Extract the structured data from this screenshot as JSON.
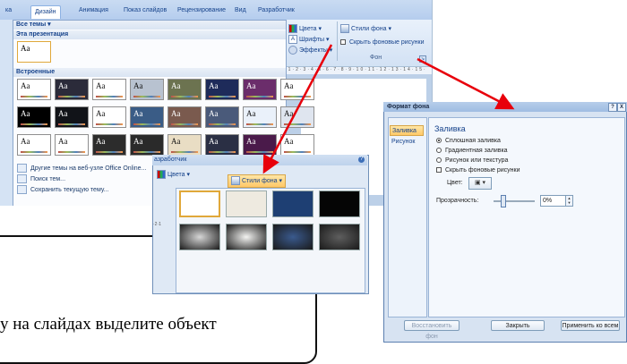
{
  "ribbon": {
    "tabs": [
      "ка",
      "Дизайн",
      "Анимация",
      "Показ слайдов",
      "Рецензирование",
      "Вид",
      "Разработчик"
    ],
    "active_tab_index": 1,
    "colors_label": "Цвета",
    "fonts_label": "Шрифты",
    "effects_label": "Эффекты",
    "bg_styles_label": "Стили фона",
    "hide_bg_graphics_label": "Скрыть фоновые рисунки",
    "group_label": "Фон",
    "ruler_text": "·1·2·3·4·5·6·7·8·9·10·11·12·13·14·15·"
  },
  "gallery": {
    "all_themes": "Все темы",
    "this_presentation": "Эта презентация",
    "builtin": "Встроенные",
    "thumb_text": "Aa",
    "menu": [
      {
        "label": "Другие темы на веб-узле Office Online...",
        "icon": "globe-icon"
      },
      {
        "label": "Поиск тем...",
        "icon": "folder-icon"
      },
      {
        "label": "Сохранить текущую тему...",
        "icon": "save-icon"
      }
    ]
  },
  "theme_colors": [
    [
      "#ffffff",
      "#2b2b3a",
      "#ffffff",
      "#b8c2d0",
      "#6c7350",
      "#1e2b5a",
      "#6b2d6b",
      "#ffffff"
    ],
    [
      "#000000",
      "#111318",
      "#ffffff",
      "#3a5c86",
      "#7a5a4e",
      "#4a5a7a",
      "#eaf1fa",
      "#dfe5ef"
    ],
    [
      "#ffffff",
      "#ffffff",
      "#2c2c2c",
      "#2a2a2a",
      "#e9ddc4",
      "#2a2f44",
      "#4a1a4a",
      "#ffffff"
    ]
  ],
  "popup": {
    "title": "азработчик",
    "colors_label": "Цвета",
    "bg_styles_label": "Стили фона",
    "scale_text": "·2·1",
    "swatches": [
      "#ffffff",
      "#eeeae0",
      "#1e3f73",
      "#050505",
      "#d6d6d6",
      "#f4f4f2",
      "#3a5a8e",
      "#5e5e5e"
    ]
  },
  "slide": {
    "text": "у на слайдах выделите объект"
  },
  "dialog": {
    "title": "Формат фона",
    "help": "?",
    "close": "X",
    "nav": [
      "Заливка",
      "Рисунок"
    ],
    "section": "Заливка",
    "options": [
      {
        "label": "Сплошная заливка",
        "kind": "radio",
        "checked": true
      },
      {
        "label": "Градиентная заливка",
        "kind": "radio",
        "checked": false
      },
      {
        "label": "Рисунок или текстура",
        "kind": "radio",
        "checked": false
      },
      {
        "label": "Скрыть фоновые рисунки",
        "kind": "check",
        "checked": false
      }
    ],
    "color_label": "Цвет:",
    "transparency_label": "Прозрачность:",
    "transparency_value": "0%",
    "reset_button": "Восстановить фон",
    "close_button": "Закрыть",
    "apply_all_button": "Применить ко всем"
  },
  "colors": {
    "accent_arrow": "#e8000b",
    "ribbon_blue": "#15428b",
    "selected_orange": "#ffc868"
  }
}
